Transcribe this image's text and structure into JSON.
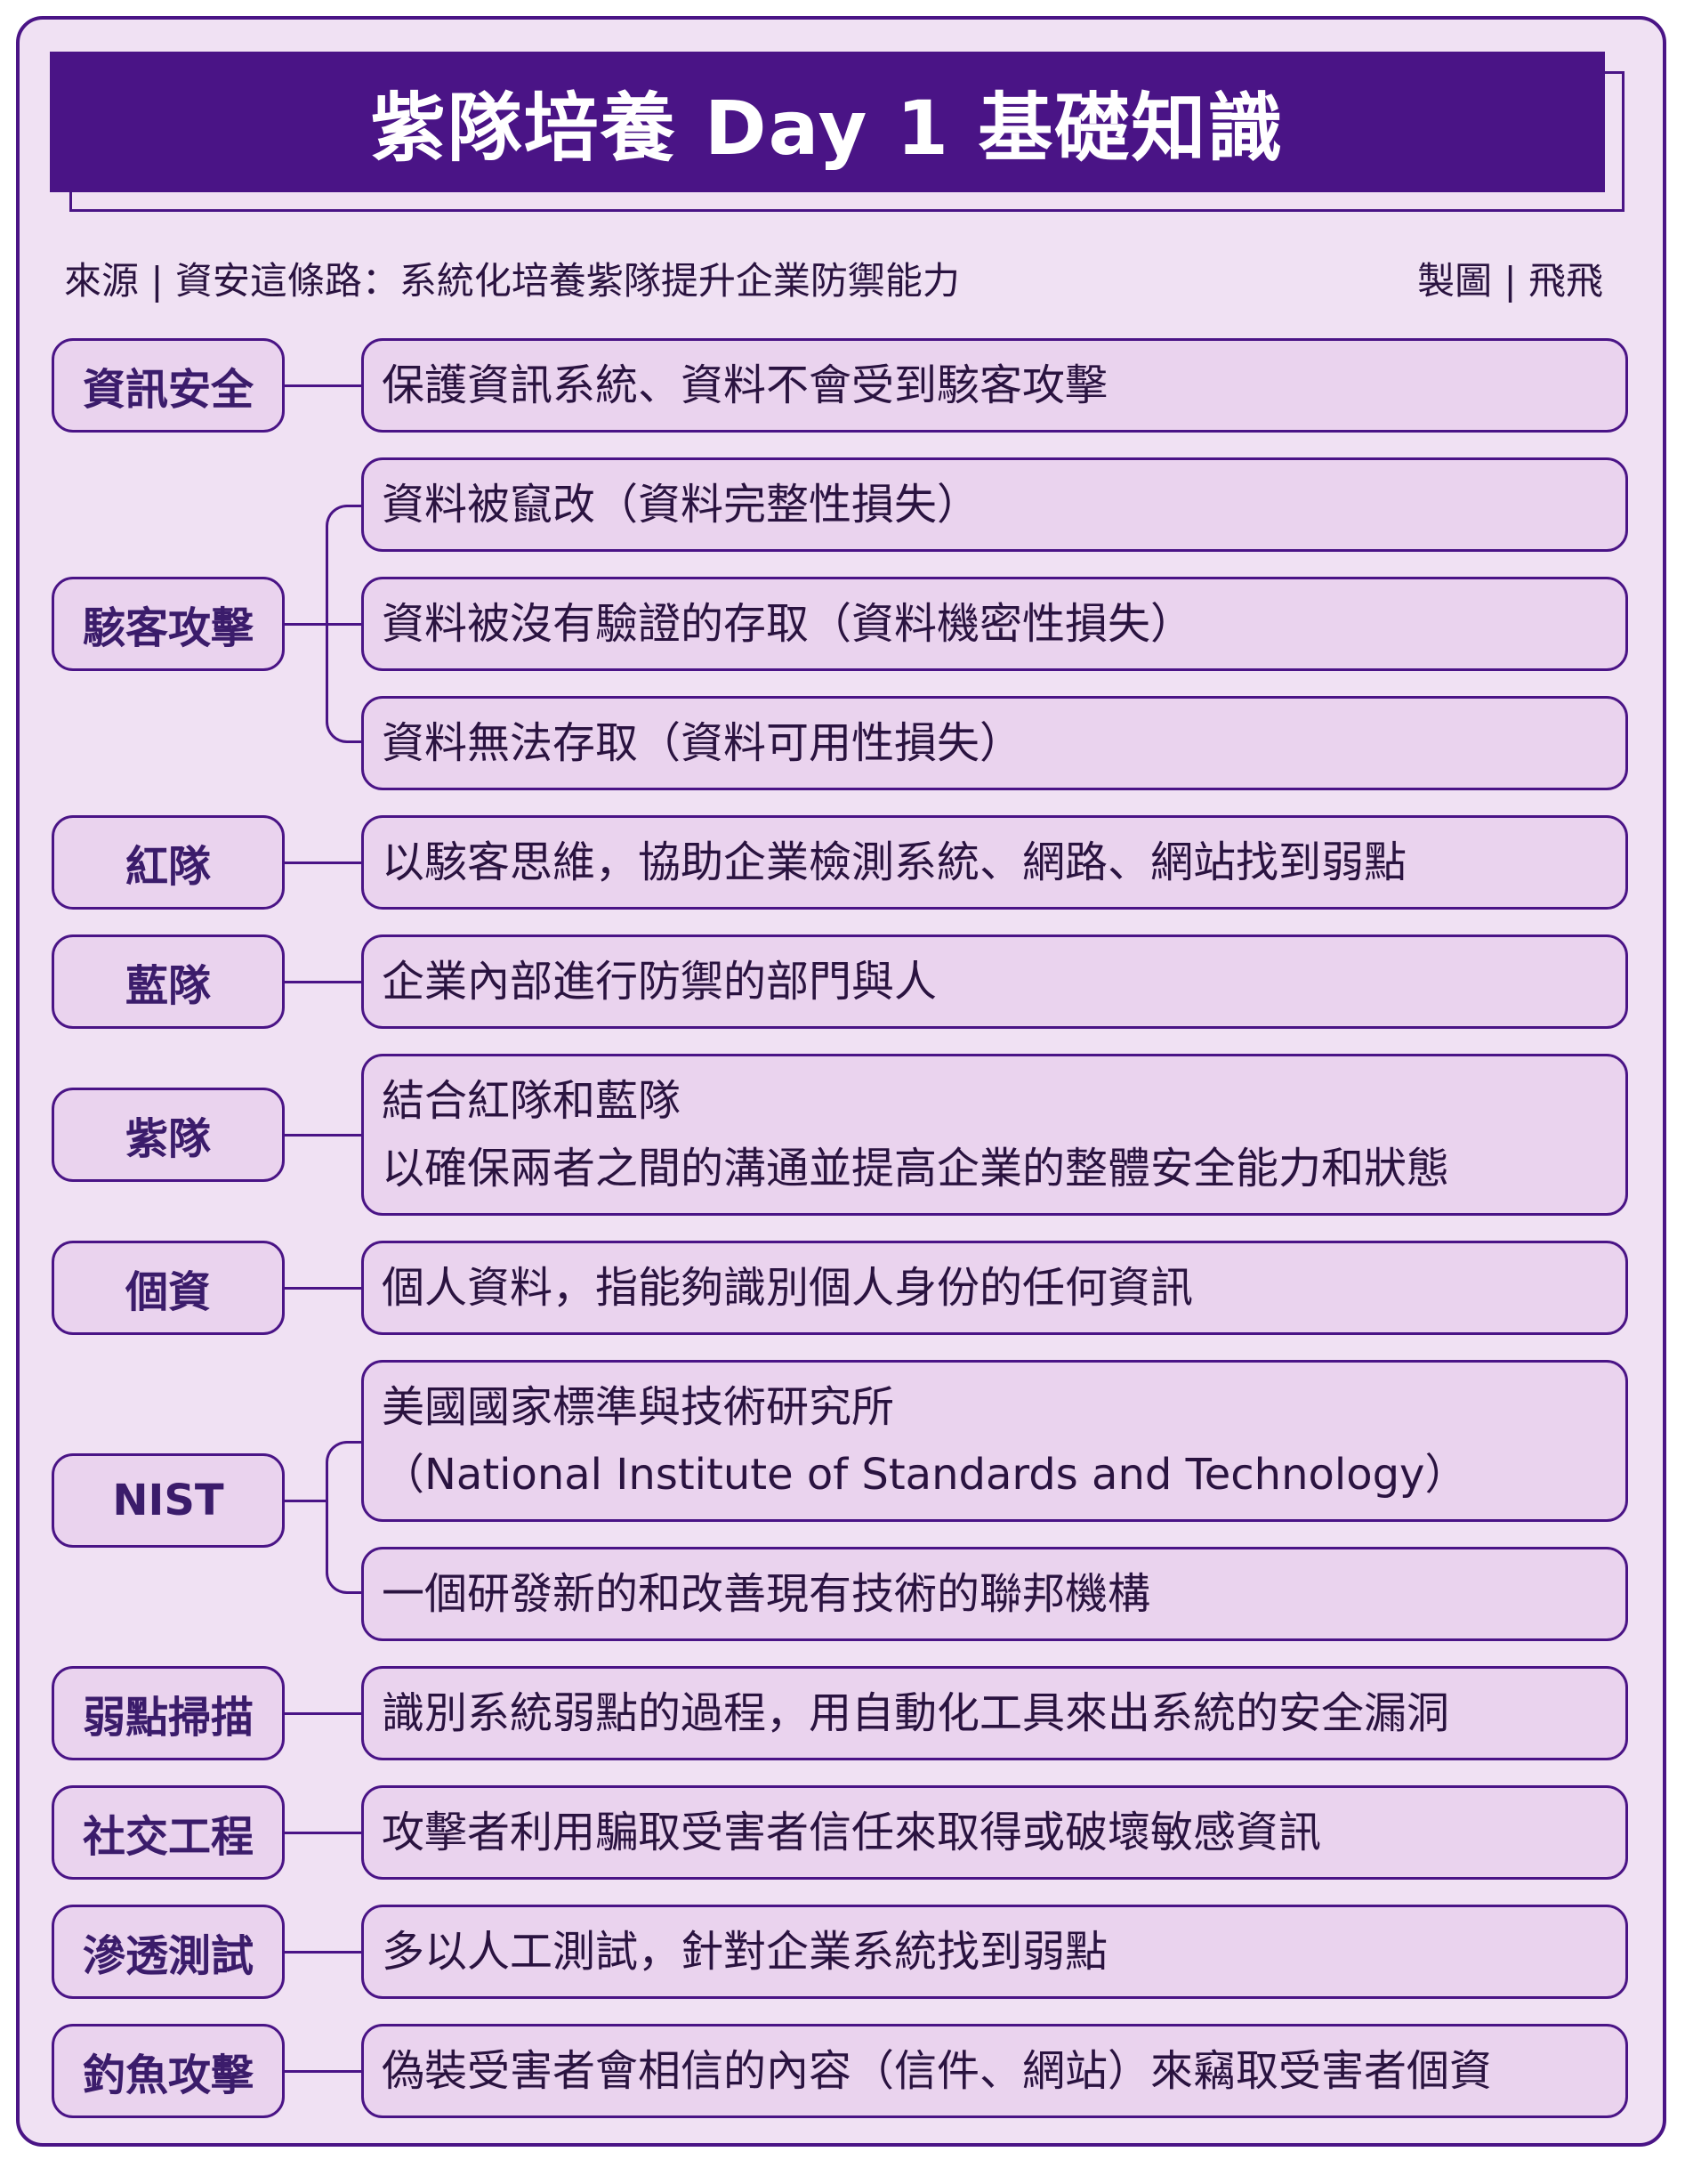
{
  "title": "紫隊培養 Day 1 基礎知識",
  "source": "來源 | 資安這條路：系統化培養紫隊提升企業防禦能力",
  "author": "製圖 | 飛飛",
  "colors": {
    "primary": "#4a1486",
    "background": "#f0e1f3",
    "box": "#ead3ee"
  },
  "terms": [
    {
      "term": "資訊安全",
      "definitions": [
        [
          "保護資訊系統、資料不會受到駭客攻擊"
        ]
      ]
    },
    {
      "term": "駭客攻擊",
      "definitions": [
        [
          "資料被竄改（資料完整性損失）"
        ],
        [
          "資料被沒有驗證的存取（資料機密性損失）"
        ],
        [
          "資料無法存取（資料可用性損失）"
        ]
      ]
    },
    {
      "term": "紅隊",
      "definitions": [
        [
          "以駭客思維，協助企業檢測系統、網路、網站找到弱點"
        ]
      ]
    },
    {
      "term": "藍隊",
      "definitions": [
        [
          "企業內部進行防禦的部門與人"
        ]
      ]
    },
    {
      "term": "紫隊",
      "definitions": [
        [
          "結合紅隊和藍隊",
          "以確保兩者之間的溝通並提高企業的整體安全能力和狀態"
        ]
      ]
    },
    {
      "term": "個資",
      "definitions": [
        [
          "個人資料，指能夠識別個人身份的任何資訊"
        ]
      ]
    },
    {
      "term": "NIST",
      "definitions": [
        [
          "美國國家標準與技術研究所",
          "（National Institute of Standards and Technology）"
        ],
        [
          "一個研發新的和改善現有技術的聯邦機構"
        ]
      ]
    },
    {
      "term": "弱點掃描",
      "definitions": [
        [
          "識別系統弱點的過程，用自動化工具來出系統的安全漏洞"
        ]
      ]
    },
    {
      "term": "社交工程",
      "definitions": [
        [
          "攻擊者利用騙取受害者信任來取得或破壞敏感資訊"
        ]
      ]
    },
    {
      "term": "滲透測試",
      "definitions": [
        [
          "多以人工測試，針對企業系統找到弱點"
        ]
      ]
    },
    {
      "term": "釣魚攻擊",
      "definitions": [
        [
          "偽裝受害者會相信的內容（信件、網站）來竊取受害者個資"
        ]
      ]
    }
  ]
}
